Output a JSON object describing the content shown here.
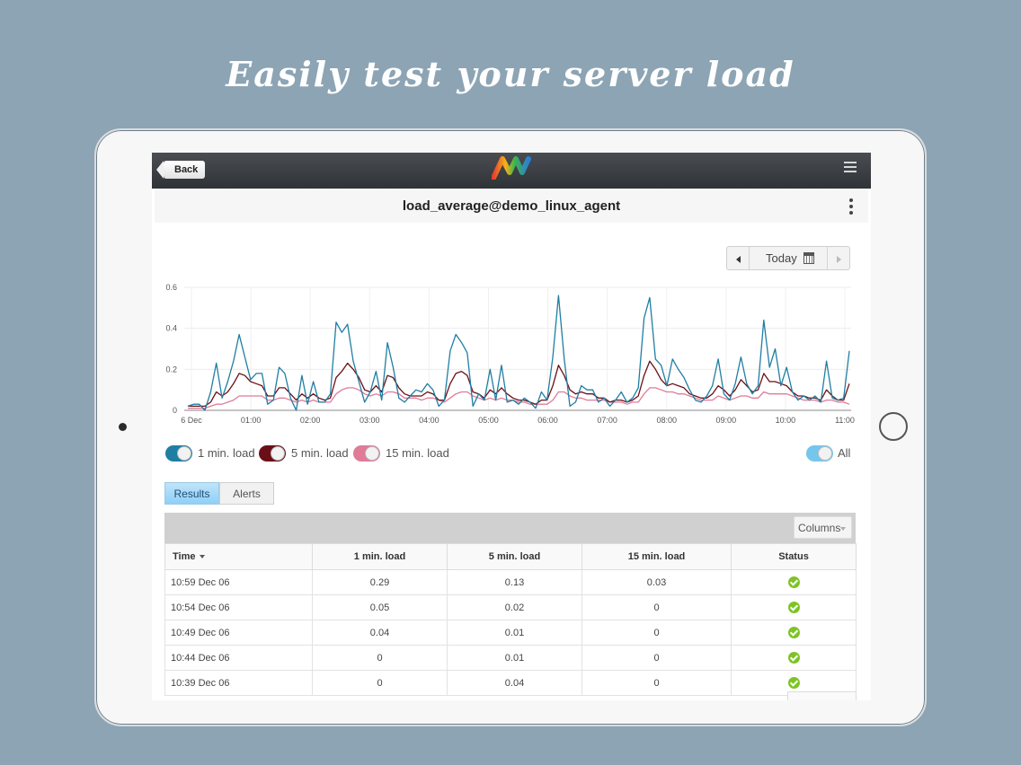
{
  "headline": "Easily test your server load",
  "topbar": {
    "back_label": "Back"
  },
  "title": "load_average@demo_linux_agent",
  "date_picker": {
    "label": "Today"
  },
  "legend": {
    "items": [
      {
        "label": "1 min. load",
        "color": "#1f7ea3"
      },
      {
        "label": "5 min. load",
        "color": "#6b0f17"
      },
      {
        "label": "15 min. load",
        "color": "#e07b98"
      }
    ],
    "all_label": "All",
    "all_color": "#74c6ec"
  },
  "tabs": [
    {
      "label": "Results",
      "active": true
    },
    {
      "label": "Alerts",
      "active": false
    }
  ],
  "grid": {
    "columns_button": "Columns",
    "headers": [
      "Time",
      "1 min. load",
      "5 min. load",
      "15 min. load",
      "Status"
    ],
    "rows": [
      {
        "time": "10:59 Dec 06",
        "l1": "0.29",
        "l5": "0.13",
        "l15": "0.03",
        "status": "ok"
      },
      {
        "time": "10:54 Dec 06",
        "l1": "0.05",
        "l5": "0.02",
        "l15": "0",
        "status": "ok"
      },
      {
        "time": "10:49 Dec 06",
        "l1": "0.04",
        "l5": "0.01",
        "l15": "0",
        "status": "ok"
      },
      {
        "time": "10:44 Dec 06",
        "l1": "0",
        "l5": "0.01",
        "l15": "0",
        "status": "ok"
      },
      {
        "time": "10:39 Dec 06",
        "l1": "0",
        "l5": "0.04",
        "l15": "0",
        "status": "ok"
      }
    ]
  },
  "chart_data": {
    "type": "line",
    "x_ticks": [
      "6 Dec",
      "01:00",
      "02:00",
      "03:00",
      "04:00",
      "05:00",
      "06:00",
      "07:00",
      "08:00",
      "09:00",
      "10:00",
      "11:00"
    ],
    "y_ticks": [
      "0",
      "0.2",
      "0.4",
      "0.6"
    ],
    "ylim": [
      0,
      0.6
    ],
    "grid": true,
    "x_start_hour": 0,
    "x_end_hour": 11,
    "series": [
      {
        "name": "1 min. load",
        "color": "#1f7ea3",
        "values": [
          0.02,
          0.03,
          0.03,
          0,
          0.09,
          0.23,
          0.06,
          0.14,
          0.24,
          0.37,
          0.26,
          0.15,
          0.18,
          0.18,
          0.03,
          0.05,
          0.21,
          0.18,
          0.06,
          0,
          0.17,
          0.03,
          0.14,
          0.04,
          0.04,
          0.08,
          0.43,
          0.38,
          0.42,
          0.24,
          0.14,
          0.04,
          0.09,
          0.19,
          0.05,
          0.33,
          0.21,
          0.06,
          0.04,
          0.07,
          0.1,
          0.09,
          0.13,
          0.1,
          0.02,
          0.05,
          0.29,
          0.37,
          0.33,
          0.28,
          0.02,
          0.08,
          0.05,
          0.2,
          0.05,
          0.22,
          0.04,
          0.05,
          0.03,
          0.06,
          0.04,
          0.01,
          0.09,
          0.05,
          0.26,
          0.56,
          0.25,
          0.02,
          0.04,
          0.12,
          0.1,
          0.1,
          0.04,
          0.06,
          0.02,
          0.05,
          0.09,
          0.04,
          0.06,
          0.11,
          0.45,
          0.55,
          0.25,
          0.22,
          0.12,
          0.25,
          0.2,
          0.16,
          0.1,
          0.05,
          0.04,
          0.07,
          0.12,
          0.25,
          0.08,
          0.05,
          0.13,
          0.26,
          0.13,
          0.08,
          0.12,
          0.44,
          0.21,
          0.3,
          0.12,
          0.21,
          0.09,
          0.05,
          0.07,
          0.05,
          0.07,
          0.04,
          0.24,
          0.06,
          0.05,
          0.06,
          0.29
        ]
      },
      {
        "name": "5 min. load",
        "color": "#6b0f17",
        "values": [
          0.02,
          0.02,
          0.02,
          0.02,
          0.04,
          0.09,
          0.07,
          0.09,
          0.13,
          0.18,
          0.17,
          0.14,
          0.13,
          0.12,
          0.07,
          0.07,
          0.11,
          0.11,
          0.08,
          0.05,
          0.08,
          0.06,
          0.08,
          0.06,
          0.05,
          0.06,
          0.16,
          0.19,
          0.23,
          0.2,
          0.16,
          0.1,
          0.09,
          0.12,
          0.09,
          0.17,
          0.16,
          0.11,
          0.08,
          0.07,
          0.07,
          0.07,
          0.09,
          0.08,
          0.05,
          0.05,
          0.13,
          0.18,
          0.19,
          0.17,
          0.09,
          0.08,
          0.06,
          0.1,
          0.08,
          0.11,
          0.08,
          0.06,
          0.05,
          0.05,
          0.04,
          0.03,
          0.05,
          0.05,
          0.12,
          0.22,
          0.17,
          0.1,
          0.08,
          0.09,
          0.08,
          0.08,
          0.06,
          0.06,
          0.04,
          0.05,
          0.05,
          0.04,
          0.05,
          0.07,
          0.17,
          0.24,
          0.2,
          0.15,
          0.12,
          0.13,
          0.12,
          0.11,
          0.08,
          0.07,
          0.06,
          0.06,
          0.08,
          0.12,
          0.1,
          0.07,
          0.1,
          0.15,
          0.12,
          0.09,
          0.1,
          0.18,
          0.14,
          0.14,
          0.13,
          0.12,
          0.09,
          0.07,
          0.07,
          0.06,
          0.06,
          0.05,
          0.1,
          0.07,
          0.05,
          0.05,
          0.13
        ]
      },
      {
        "name": "15 min. load",
        "color": "#e07b98",
        "values": [
          0.01,
          0.01,
          0.01,
          0.01,
          0.02,
          0.03,
          0.03,
          0.04,
          0.05,
          0.07,
          0.07,
          0.07,
          0.07,
          0.07,
          0.05,
          0.05,
          0.06,
          0.06,
          0.05,
          0.04,
          0.05,
          0.04,
          0.05,
          0.04,
          0.04,
          0.04,
          0.08,
          0.1,
          0.11,
          0.11,
          0.1,
          0.08,
          0.07,
          0.08,
          0.07,
          0.09,
          0.09,
          0.08,
          0.06,
          0.06,
          0.06,
          0.05,
          0.06,
          0.06,
          0.05,
          0.04,
          0.06,
          0.08,
          0.09,
          0.09,
          0.07,
          0.06,
          0.05,
          0.06,
          0.05,
          0.06,
          0.05,
          0.05,
          0.04,
          0.04,
          0.03,
          0.03,
          0.03,
          0.03,
          0.05,
          0.09,
          0.09,
          0.07,
          0.06,
          0.06,
          0.05,
          0.05,
          0.05,
          0.05,
          0.04,
          0.04,
          0.04,
          0.03,
          0.04,
          0.04,
          0.08,
          0.11,
          0.11,
          0.1,
          0.09,
          0.09,
          0.08,
          0.08,
          0.07,
          0.06,
          0.05,
          0.05,
          0.05,
          0.07,
          0.06,
          0.05,
          0.06,
          0.07,
          0.07,
          0.06,
          0.06,
          0.09,
          0.08,
          0.08,
          0.08,
          0.08,
          0.07,
          0.06,
          0.05,
          0.05,
          0.05,
          0.04,
          0.05,
          0.05,
          0.04,
          0.04,
          0.03
        ]
      }
    ]
  }
}
